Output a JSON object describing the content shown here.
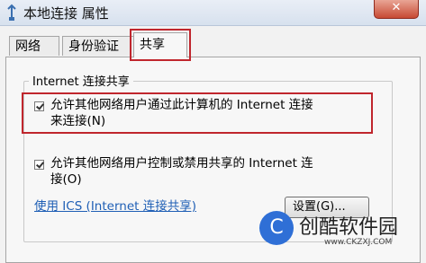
{
  "window": {
    "title": "本地连接 属性",
    "close_label": "✕"
  },
  "tabs": [
    "网络",
    "身份验证",
    "共享"
  ],
  "group": {
    "label": "Internet 连接共享"
  },
  "option1": {
    "line1": "允许其他网络用户通过此计算机的 Internet 连接",
    "line2": "来连接(N)",
    "checked": true
  },
  "option2": {
    "line1": "允许其他网络用户控制或禁用共享的 Internet 连",
    "line2": "接(O)",
    "checked": true
  },
  "link": "使用 ICS (Internet 连接共享)",
  "settings_button": "设置(G)...",
  "watermark": {
    "brand": "创酷软件园",
    "url": "www.CKZXJ.COM",
    "logo_letter": "C"
  },
  "colors": {
    "highlight": "#c0262d",
    "link": "#1f5fb5"
  }
}
